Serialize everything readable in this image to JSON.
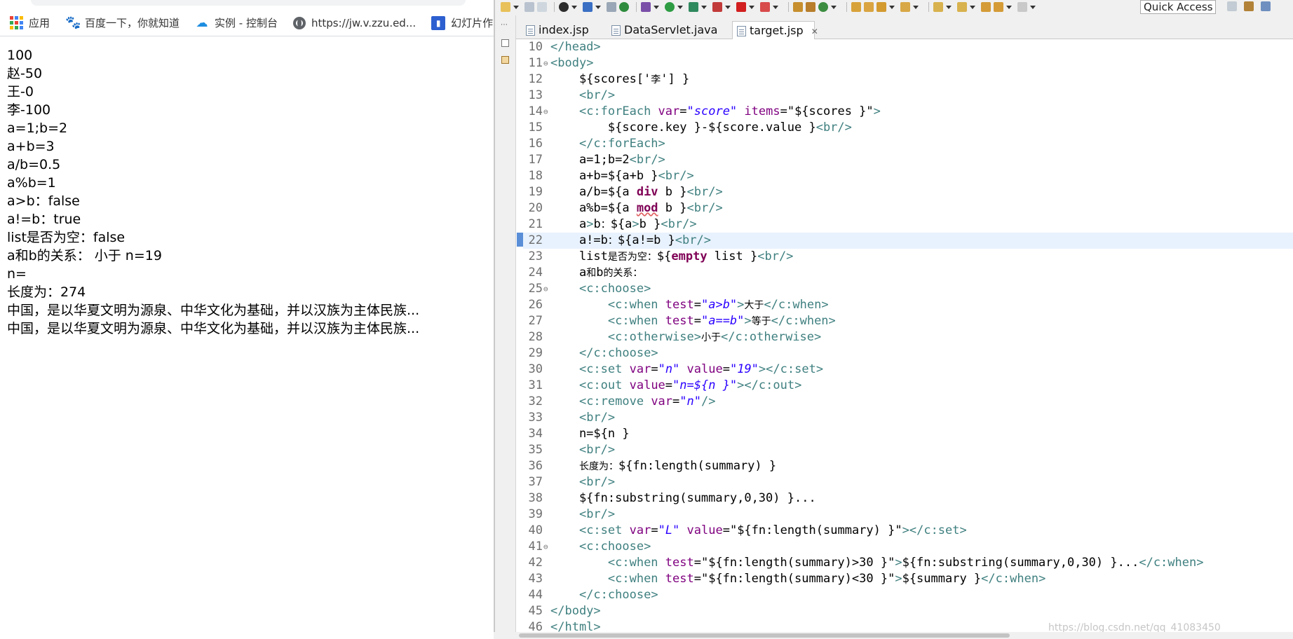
{
  "browser": {
    "bookmarks": [
      {
        "icon": "apps-grid-icon",
        "label": "应用"
      },
      {
        "icon": "baidu-paw-icon",
        "label": "百度一下，你就知道"
      },
      {
        "icon": "cloud-icon",
        "label": "实例 - 控制台"
      },
      {
        "icon": "globe-icon",
        "label": "https://jw.v.zzu.ed..."
      },
      {
        "icon": "slides-icon",
        "label": "幻灯片作"
      }
    ],
    "output_lines": [
      "100",
      "赵-50",
      "王-0",
      "李-100",
      "a=1;b=2",
      "a+b=3",
      "a/b=0.5",
      "a%b=1",
      "a>b：false",
      "a!=b：true",
      "list是否为空：false",
      "a和b的关系： 小于 n=19",
      "n=",
      "长度为：274",
      "中国，是以华夏文明为源泉、中华文化为基础，并以汉族为主体民族...",
      "中国，是以华夏文明为源泉、中华文化为基础，并以汉族为主体民族..."
    ]
  },
  "eclipse": {
    "quick_access": "Quick Access",
    "tabs": [
      {
        "label": "index.jsp",
        "active": false
      },
      {
        "label": "DataServlet.java",
        "active": false
      },
      {
        "label": "target.jsp",
        "active": true,
        "close": "✕"
      }
    ],
    "code_lines": [
      {
        "n": "10",
        "text": "</head>"
      },
      {
        "n": "11",
        "text": "<body>"
      },
      {
        "n": "12",
        "text": "    ${scores['李'] }"
      },
      {
        "n": "13",
        "text": "    <br/>"
      },
      {
        "n": "14",
        "text": "    <c:forEach var=\"score\" items=\"${scores }\">"
      },
      {
        "n": "15",
        "text": "        ${score.key }-${score.value }<br/>"
      },
      {
        "n": "16",
        "text": "    </c:forEach>"
      },
      {
        "n": "17",
        "text": "    a=1;b=2<br/>"
      },
      {
        "n": "18",
        "text": "    a+b=${a+b }<br/>"
      },
      {
        "n": "19",
        "text": "    a/b=${a div b }<br/>"
      },
      {
        "n": "20",
        "text": "    a%b=${a mod b }<br/>"
      },
      {
        "n": "21",
        "text": "    a>b：${a>b }<br/>"
      },
      {
        "n": "22",
        "text": "    a!=b：${a!=b }<br/>"
      },
      {
        "n": "23",
        "text": "    list是否为空：${empty list }<br/>"
      },
      {
        "n": "24",
        "text": "    a和b的关系："
      },
      {
        "n": "25",
        "text": "    <c:choose>"
      },
      {
        "n": "26",
        "text": "        <c:when test=\"a>b\">大于</c:when>"
      },
      {
        "n": "27",
        "text": "        <c:when test=\"a==b\">等于</c:when>"
      },
      {
        "n": "28",
        "text": "        <c:otherwise>小于</c:otherwise>"
      },
      {
        "n": "29",
        "text": "    </c:choose>"
      },
      {
        "n": "30",
        "text": "    <c:set var=\"n\" value=\"19\"></c:set>"
      },
      {
        "n": "31",
        "text": "    <c:out value=\"n=${n }\"></c:out>"
      },
      {
        "n": "32",
        "text": "    <c:remove var=\"n\"/>"
      },
      {
        "n": "33",
        "text": "    <br/>"
      },
      {
        "n": "34",
        "text": "    n=${n }"
      },
      {
        "n": "35",
        "text": "    <br/>"
      },
      {
        "n": "36",
        "text": "    长度为：${fn:length(summary) }"
      },
      {
        "n": "37",
        "text": "    <br/>"
      },
      {
        "n": "38",
        "text": "    ${fn:substring(summary,0,30) }..."
      },
      {
        "n": "39",
        "text": "    <br/>"
      },
      {
        "n": "40",
        "text": "    <c:set var=\"L\" value=\"${fn:length(summary) }\"></c:set>"
      },
      {
        "n": "41",
        "text": "    <c:choose>"
      },
      {
        "n": "42",
        "text": "        <c:when test=\"${fn:length(summary)>30 }\">${fn:substring(summary,0,30) }...</c:when>"
      },
      {
        "n": "43",
        "text": "        <c:when test=\"${fn:length(summary)<30 }\">${summary }</c:when>"
      },
      {
        "n": "44",
        "text": "    </c:choose>"
      },
      {
        "n": "45",
        "text": "</body>"
      },
      {
        "n": "46",
        "text": "</html>"
      }
    ],
    "current_line": "22",
    "fold_lines": [
      "11",
      "14",
      "25",
      "41"
    ],
    "watermark": "https://blog.csdn.net/qq_41083450"
  },
  "colors": {
    "tag": "#3f7f7f",
    "attribute": "#7f007f",
    "string": "#2a00ff",
    "keyword": "#7f0055",
    "current_line": "#e8f2fe",
    "line_number": "#6e6e6e"
  }
}
